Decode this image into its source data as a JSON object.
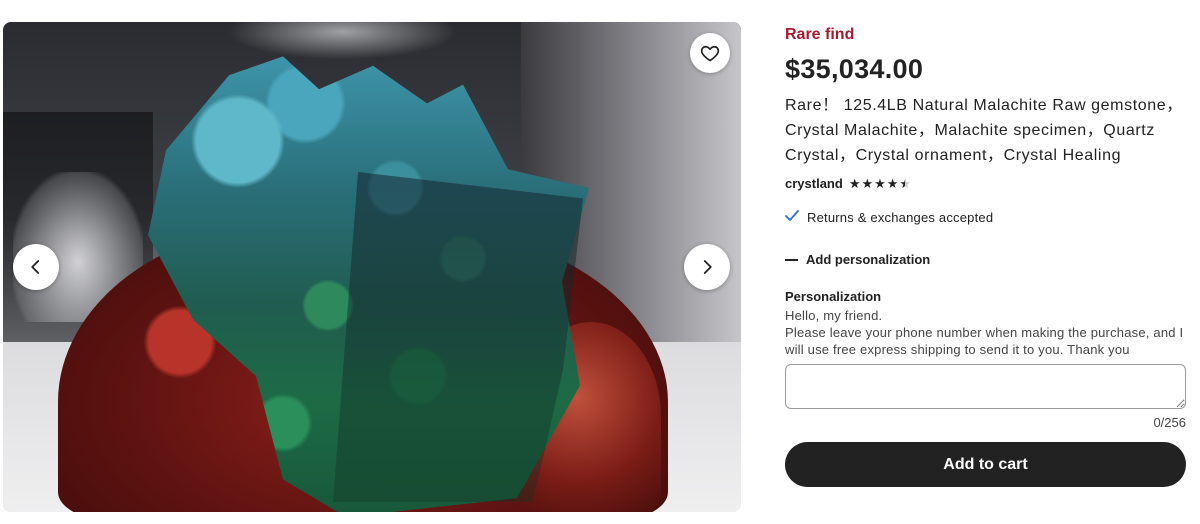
{
  "gallery": {
    "favorite_icon": "heart-outline-icon",
    "prev_icon": "chevron-left-icon",
    "next_icon": "chevron-right-icon"
  },
  "product": {
    "badge": "Rare find",
    "price": "$35,034.00",
    "title": "Rare！ 125.4LB Natural Malachite Raw gemstone，Crystal Malachite，Malachite specimen，Quartz Crystal，Crystal ornament，Crystal Healing",
    "shop_name": "crystland",
    "rating": 4.5,
    "returns_text": "Returns & exchanges accepted"
  },
  "personalization": {
    "toggle_label": "Add personalization",
    "title": "Personalization",
    "line1": "Hello, my friend.",
    "line2": "Please leave your phone number when making the purchase, and I will use free express shipping to send it to you. Thank you",
    "input_value": "",
    "counter": "0/256"
  },
  "actions": {
    "add_to_cart": "Add to cart"
  },
  "colors": {
    "badge": "#a61a2e",
    "check": "#2f6fd6",
    "button_bg": "#222222"
  }
}
